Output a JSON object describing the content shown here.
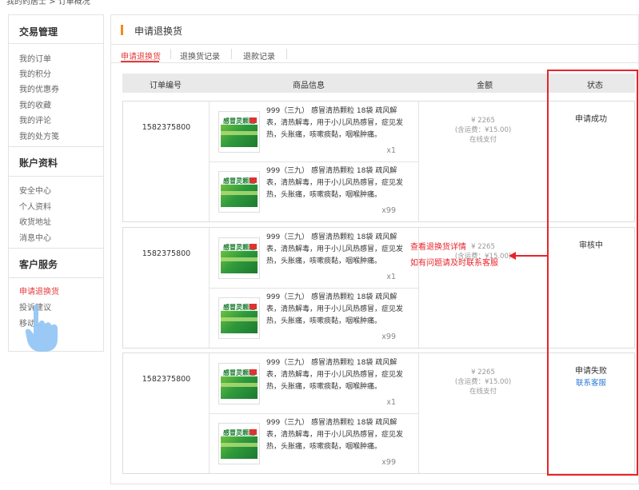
{
  "breadcrumb": "我的药居士 > 订单概况",
  "sidebar": {
    "sections": [
      {
        "title": "交易管理",
        "items": [
          "我的订单",
          "我的积分",
          "我的优惠券",
          "我的收藏",
          "我的评论",
          "我的处方笺"
        ]
      },
      {
        "title": "账户资料",
        "items": [
          "安全中心",
          "个人资料",
          "收货地址",
          "消息中心"
        ]
      },
      {
        "title": "客户服务",
        "items": [
          "申请退换货",
          "投诉建议",
          "移动..."
        ]
      }
    ]
  },
  "main": {
    "title": "申请退换货",
    "tabs": [
      "申请退换货",
      "退换货记录",
      "退款记录"
    ],
    "columns": [
      "订单编号",
      "商品信息",
      "金额",
      "状态"
    ]
  },
  "product_desc": "999（三九） 感冒清热颗粒 18袋 疏风解表，清热解毒，用于小儿风热感冒，症见发热，头胀痛，咳嗽痰黏，咽喉肿痛。",
  "product_box_label": "感冒灵颗粒",
  "orders": [
    {
      "id": "1582375800",
      "price": "¥ 2265",
      "freight": "(含运费：¥15.00)",
      "pay": "在线支付",
      "status": "申请成功",
      "link": "",
      "products": [
        {
          "qty": "x1"
        },
        {
          "qty": "x99"
        }
      ]
    },
    {
      "id": "1582375800",
      "price": "¥ 2265",
      "freight": "(含运费：¥15.00)",
      "pay": "",
      "status": "审核中",
      "link": "",
      "products": [
        {
          "qty": "x1"
        },
        {
          "qty": "x99"
        }
      ]
    },
    {
      "id": "1582375800",
      "price": "¥ 2265",
      "freight": "(含运费：¥15.00)",
      "pay": "在线支付",
      "status": "申请失败",
      "link": "联系客服",
      "products": [
        {
          "qty": "x1"
        },
        {
          "qty": "x99"
        }
      ]
    }
  ],
  "annotation": {
    "line1": "查看退换货详情",
    "line2": "如有问题请及时联系客服"
  },
  "colors": {
    "accent_red": "#e53b3b",
    "orange": "#f28a1f",
    "link_blue": "#2b7ad8",
    "annotation_red": "#e8242b"
  }
}
